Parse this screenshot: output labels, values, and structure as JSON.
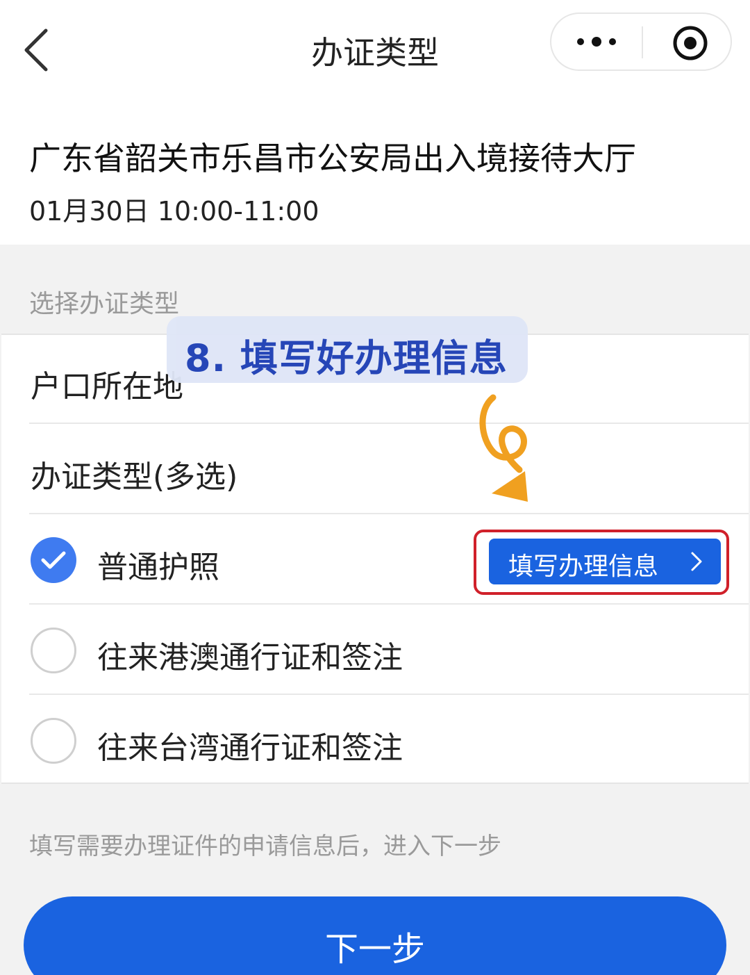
{
  "nav": {
    "title": "办证类型",
    "back_icon": "chevron-left-icon",
    "more_icon": "more-dots-icon",
    "close_icon": "target-circle-icon"
  },
  "hall": {
    "name": "广东省韶关市乐昌市公安局出入境接待大厅",
    "time": "01月30日 10:00-11:00"
  },
  "section_title": "选择办证类型",
  "form": {
    "hukou_label": "户口所在地",
    "type_label": "办证类型(多选)",
    "options": [
      {
        "label": "普通护照",
        "checked": true
      },
      {
        "label": "往来港澳通行证和签注",
        "checked": false
      },
      {
        "label": "往来台湾通行证和签注",
        "checked": false
      }
    ],
    "fill_button_label": "填写办理信息"
  },
  "annotation": {
    "text": "8. 填写好办理信息",
    "highlight_color": "#d0202a",
    "arrow_color": "#f0a020"
  },
  "hint": "填写需要办理证件的申请信息后，进入下一步",
  "next_button_label": "下一步",
  "colors": {
    "primary": "#1a63e0",
    "checkbox": "#3f7bf0",
    "annotation_bg": "#dfe6f7",
    "annotation_text": "#1e3fb5"
  }
}
